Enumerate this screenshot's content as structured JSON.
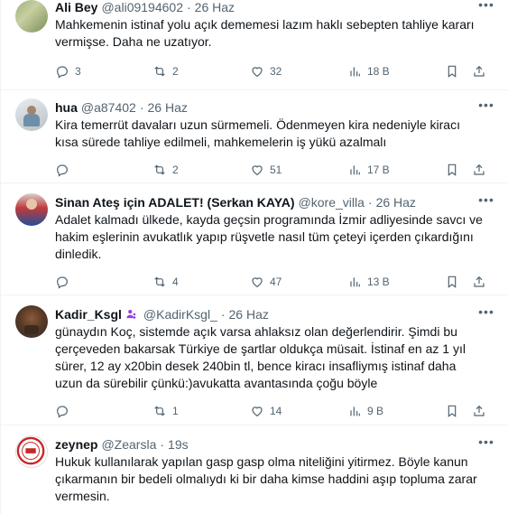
{
  "tweets": [
    {
      "name": "Ali Bey",
      "handle": "@ali09194602",
      "dot": "·",
      "time": "26 Haz",
      "text": "Mahkemenin istinaf yolu açık dememesi lazım haklı sebepten tahliye kararı vermişse. Daha ne uzatıyor.",
      "replies": "3",
      "retweets": "2",
      "likes": "32",
      "views": "18 B"
    },
    {
      "name": "hua",
      "handle": "@a87402",
      "dot": "·",
      "time": "26 Haz",
      "text": "Kira temerrüt davaları uzun sürmemeli. Ödenmeyen kira nedeniyle kiracı kısa sürede tahliye edilmeli, mahkemelerin iş yükü azalmalı",
      "replies": "",
      "retweets": "2",
      "likes": "51",
      "views": "17 B"
    },
    {
      "name": "Sinan Ateş için ADALET! (Serkan KAYA)",
      "handle": "@kore_villa",
      "dot": "·",
      "time": "26 Haz",
      "text": "Adalet kalmadı ülkede, kayda geçsin programında İzmir adliyesinde savcı ve hakim eşlerinin avukatlık yapıp rüşvetle nasıl tüm çeteyi içerden çıkardığını dinledik.",
      "replies": "",
      "retweets": "4",
      "likes": "47",
      "views": "13 B"
    },
    {
      "name": "Kadir_Ksgl",
      "handle": "@KadirKsgl_",
      "dot": "·",
      "time": "26 Haz",
      "text": "günaydın Koç, sistemde açık varsa ahlaksız olan değerlendirir. Şimdi bu çerçeveden bakarsak Türkiye de şartlar oldukça müsait. İstinaf en az 1 yıl sürer, 12 ay x20bin desek 240bin tl, bence kiracı insafliymış istinaf daha uzun da sürebilir çünkü:)avukatta avantasında çoğu böyle",
      "replies": "",
      "retweets": "1",
      "likes": "14",
      "views": "9 B"
    },
    {
      "name": "zeynep",
      "handle": "@Zearsla",
      "dot": "·",
      "time": "19s",
      "text": "Hukuk kullanılarak yapılan gasp gasp olma niteliğini yitirmez. Böyle kanun çıkarmanın bir bedeli olmalıydı ki bir daha kimse haddini aşıp topluma zarar vermesin.",
      "replies": "",
      "retweets": "",
      "likes": "",
      "views": ""
    }
  ],
  "icons": {
    "reply": "reply-icon",
    "retweet": "retweet-icon",
    "like": "like-icon",
    "views": "views-icon",
    "bookmark": "bookmark-icon",
    "share": "share-icon",
    "more": "more-icon"
  },
  "colors": {
    "text": "#0f1419",
    "muted": "#536471",
    "divider": "#eff3f4",
    "badge": "#9b3fd9"
  }
}
